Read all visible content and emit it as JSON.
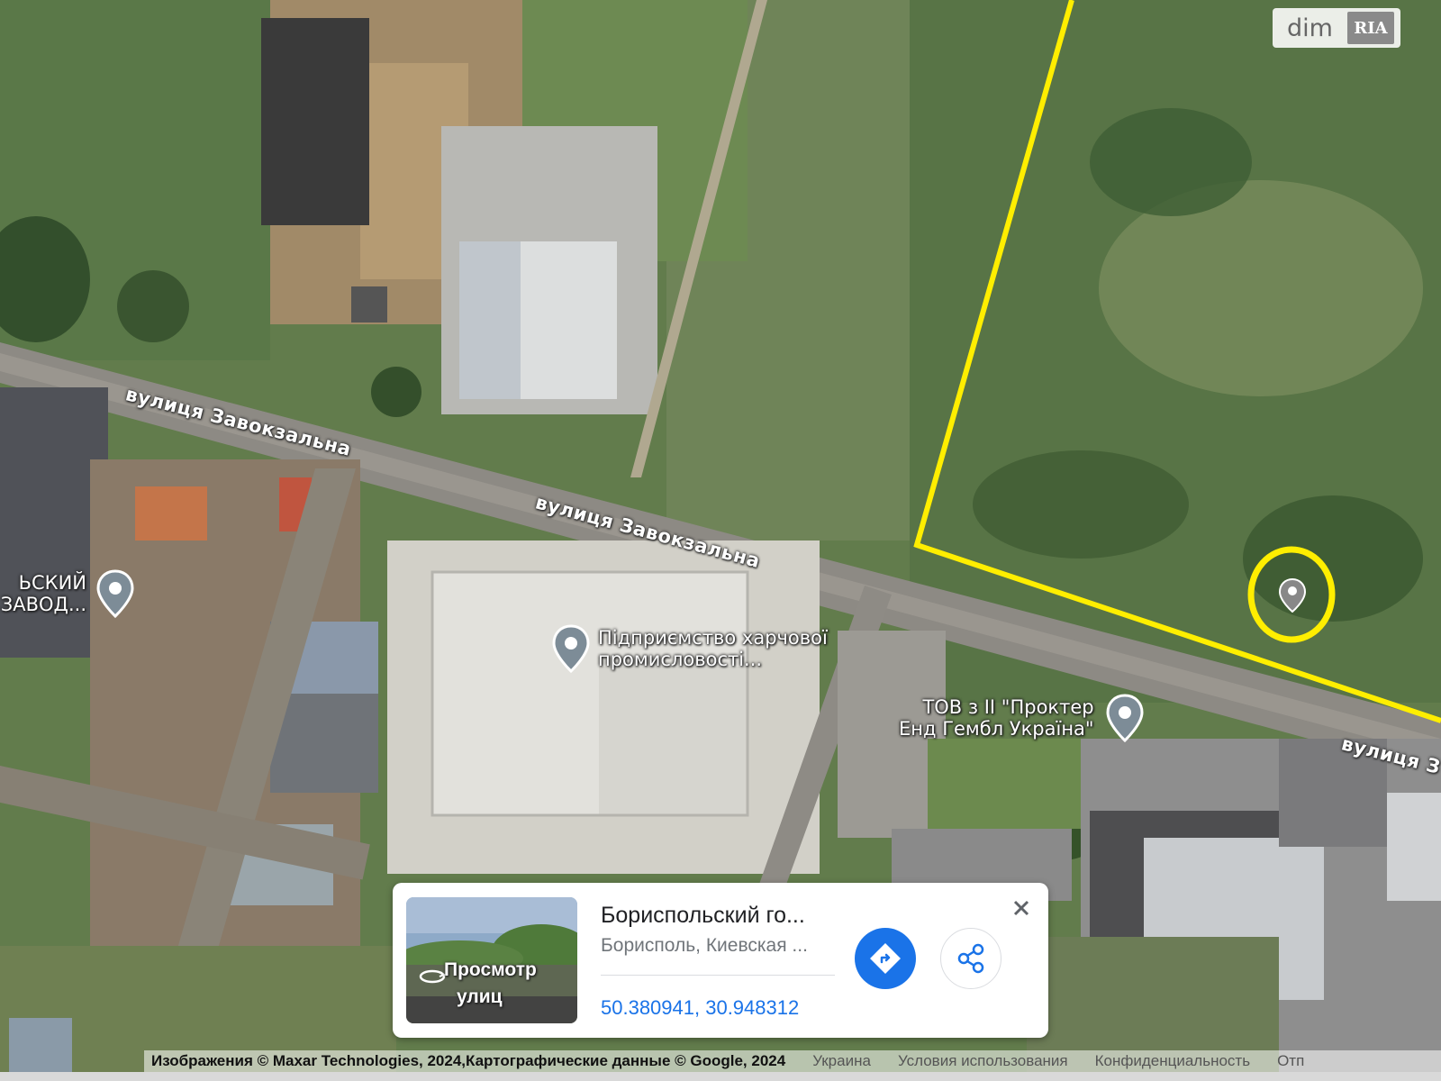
{
  "watermark": {
    "text": "dim",
    "badge": "RIA"
  },
  "streets": {
    "label_1": "вулиця Завокзальна",
    "label_2": "вулиця Завокзальна",
    "label_3": "вулиця З"
  },
  "pois": {
    "poi_left": {
      "line1": "ЬСКИЙ",
      "line2": "ЗАВОД..."
    },
    "poi_center": {
      "line1": "Підприємство харчової",
      "line2": "промисловості..."
    },
    "poi_right": {
      "line1": "ТОВ з ІІ \"Проктер",
      "line2": "Енд Гембл Україна\""
    }
  },
  "place_card": {
    "title": "Бориспольский го...",
    "address": "Борисполь, Киевская ...",
    "coordinates": "50.380941, 30.948312",
    "street_view_label_line1": "Просмотр",
    "street_view_label_line2": "улиц",
    "close_icon": "close-icon",
    "directions_icon": "directions-icon",
    "share_icon": "share-icon"
  },
  "footer": {
    "attribution": "Изображения © Maxar Technologies, 2024,Картографические данные © Google, 2024",
    "links": [
      "Украина",
      "Условия использования",
      "Конфиденциальность",
      "Отп"
    ]
  },
  "colors": {
    "boundary": "#ffee00",
    "accent": "#1a73e8"
  }
}
